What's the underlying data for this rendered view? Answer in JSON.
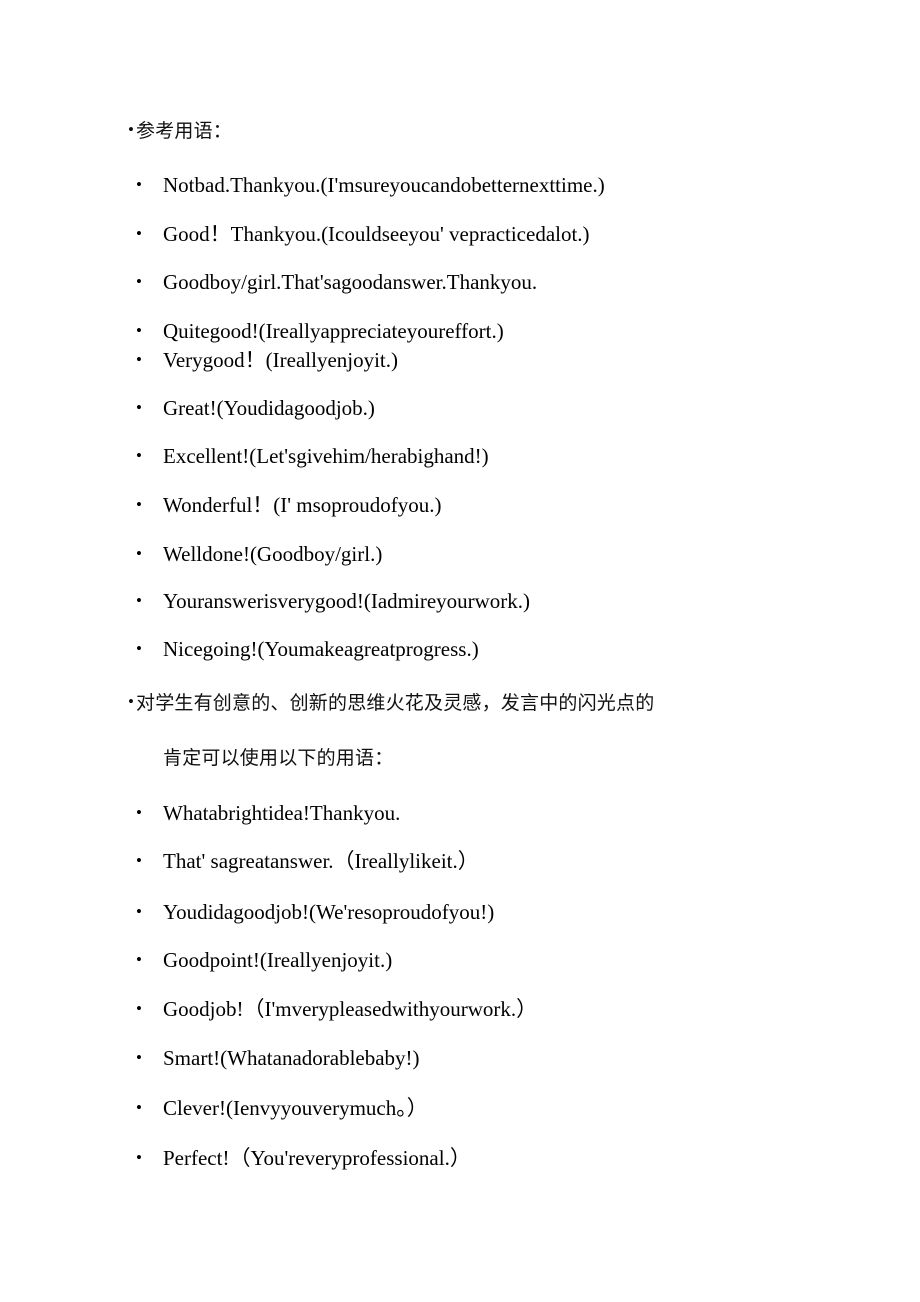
{
  "document": {
    "background_color": "#ffffff",
    "text_color": "#000000",
    "bullet_glyph": "•",
    "heading_bullet_glyph": "•"
  },
  "sections": [
    {
      "heading": "参考用语：",
      "heading_continuation": "",
      "items": [
        "Notbad.Thankyou.(I'msureyoucandobetternexttime.)",
        "Good！Thankyou.(Icouldseeyou' vepracticedalot.)",
        "Goodboy/girl.That'sagoodanswer.Thankyou.",
        "Quitegood!(Ireallyappreciateyoureffort.)",
        "Verygood！(Ireallyenjoyit.)",
        "Great!(Youdidagoodjob.)",
        "Excellent!(Let'sgivehim/herabighand!)",
        "Wonderful！(I' msoproudofyou.)",
        "Welldone!(Goodboy/girl.)",
        "Youranswerisverygood!(Iadmireyourwork.)",
        "Nicegoing!(Youmakeagreatprogress.)"
      ]
    },
    {
      "heading": "对学生有创意的、创新的思维火花及灵感，发言中的闪光点的",
      "heading_continuation": "肯定可以使用以下的用语：",
      "items": [
        "Whatabrightidea!Thankyou.",
        "That' sagreatanswer.（Ireallylikeit.）",
        "Youdidagoodjob!(We'resoproudofyou!)",
        "Goodpoint!(Ireallyenjoyit.)",
        "Goodjob!（I'mverypleasedwithyourwork.）",
        "Smart!(Whatanadorablebaby!)",
        "Clever!(Ienvyyouverymuch。）",
        "Perfect!（You'reveryprofessional.）"
      ]
    }
  ]
}
